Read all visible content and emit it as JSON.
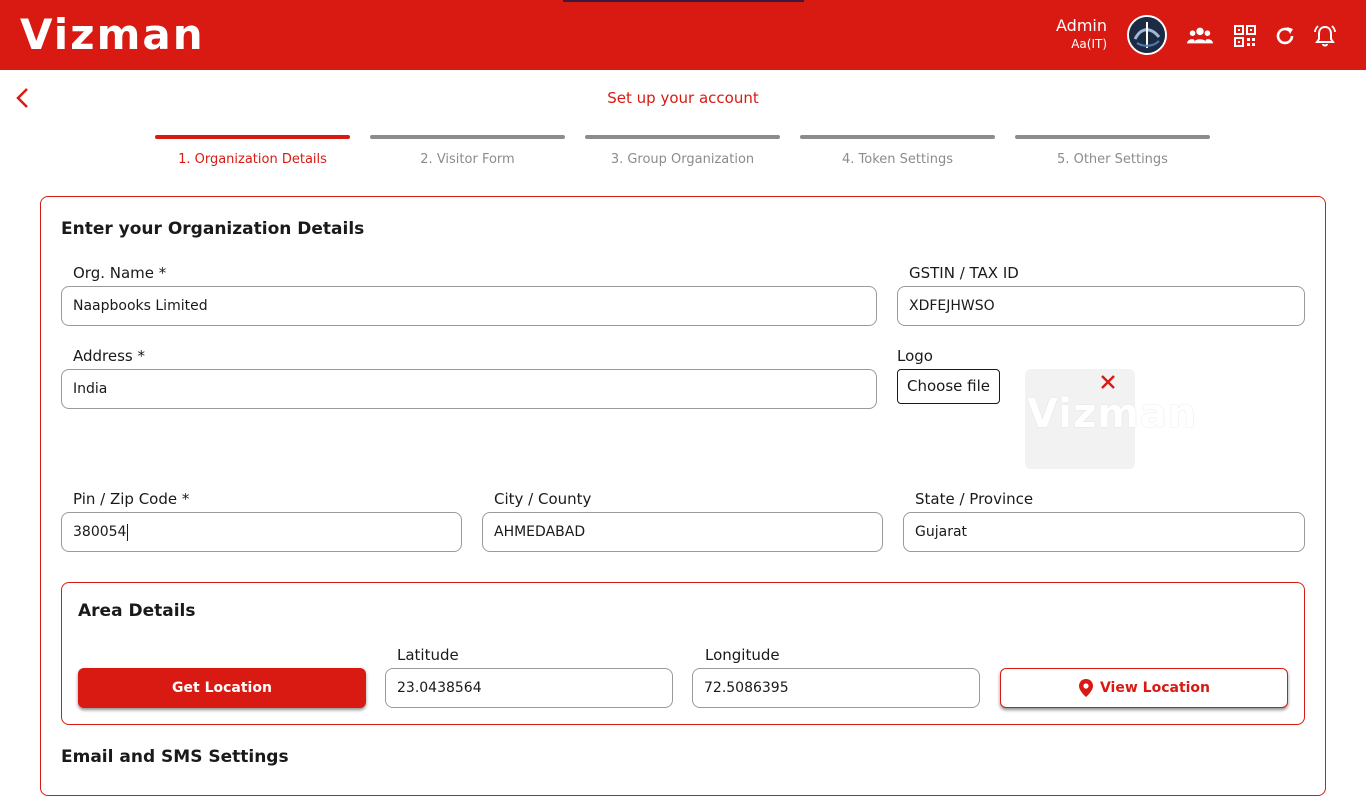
{
  "header": {
    "brand": "Vizman",
    "user_name": "Admin",
    "user_role": "Aa(IT)",
    "icons": [
      "avatar",
      "users-icon",
      "qr-code-icon",
      "refresh-icon",
      "bell-icon"
    ]
  },
  "page": {
    "title": "Set up your account"
  },
  "steps": [
    {
      "label": "1. Organization Details",
      "active": true
    },
    {
      "label": "2. Visitor Form",
      "active": false
    },
    {
      "label": "3. Group Organization",
      "active": false
    },
    {
      "label": "4. Token Settings",
      "active": false
    },
    {
      "label": "5. Other Settings",
      "active": false
    }
  ],
  "org_section": {
    "title": "Enter your Organization Details",
    "org_name_label": "Org. Name *",
    "org_name_value": "Naapbooks Limited",
    "gstin_label": "GSTIN / TAX ID",
    "gstin_value": "XDFEJHWSO",
    "address_label": "Address *",
    "address_value": "India",
    "logo_label": "Logo",
    "choose_file": "Choose file",
    "logo_watermark": "Vizman",
    "pin_label": "Pin / Zip Code *",
    "pin_value": "380054",
    "city_label": "City / County",
    "city_value": "AHMEDABAD",
    "state_label": "State / Province",
    "state_value": "Gujarat"
  },
  "area_section": {
    "title": "Area Details",
    "get_location": "Get Location",
    "latitude_label": "Latitude",
    "latitude_value": "23.0438564",
    "longitude_label": "Longitude",
    "longitude_value": "72.5086395",
    "view_location": "View Location"
  },
  "email_section": {
    "title": "Email and SMS Settings"
  },
  "colors": {
    "brand": "#d91a12",
    "muted": "#8c8c8c",
    "border": "#9a9a9a"
  }
}
